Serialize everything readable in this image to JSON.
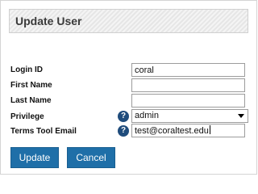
{
  "dialog": {
    "title": "Update User"
  },
  "form": {
    "login_id": {
      "label": "Login ID",
      "value": "coral"
    },
    "first_name": {
      "label": "First Name",
      "value": ""
    },
    "last_name": {
      "label": "Last Name",
      "value": ""
    },
    "privilege": {
      "label": "Privilege",
      "selected": "admin",
      "help_icon": "question-mark"
    },
    "terms_tool_email": {
      "label": "Terms Tool Email",
      "value": "test@coraltest.edu",
      "help_icon": "question-mark"
    }
  },
  "buttons": {
    "update_label": "Update",
    "cancel_label": "Cancel"
  },
  "colors": {
    "button_bg": "#1f6fa8",
    "help_icon_bg": "#1f4c7c"
  }
}
